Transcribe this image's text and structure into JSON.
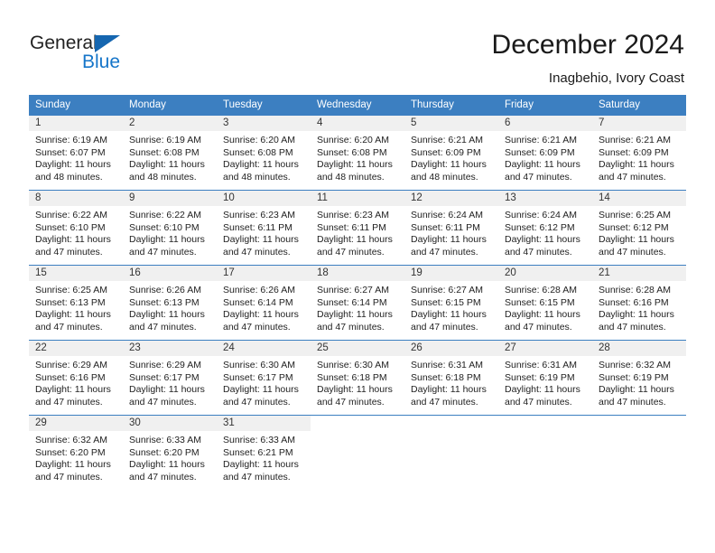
{
  "brand": {
    "name_part1": "General",
    "name_part2": "Blue"
  },
  "header": {
    "title": "December 2024",
    "subtitle": "Inagbehio, Ivory Coast"
  },
  "colors": {
    "header_blue": "#3c7fc1",
    "logo_blue": "#1575c9",
    "daynum_band": "#f0f0f0"
  },
  "calendar": {
    "weekday_headers": [
      "Sunday",
      "Monday",
      "Tuesday",
      "Wednesday",
      "Thursday",
      "Friday",
      "Saturday"
    ],
    "weeks": [
      [
        {
          "day": "1",
          "sunrise": "Sunrise: 6:19 AM",
          "sunset": "Sunset: 6:07 PM",
          "daylight_line1": "Daylight: 11 hours",
          "daylight_line2": "and 48 minutes."
        },
        {
          "day": "2",
          "sunrise": "Sunrise: 6:19 AM",
          "sunset": "Sunset: 6:08 PM",
          "daylight_line1": "Daylight: 11 hours",
          "daylight_line2": "and 48 minutes."
        },
        {
          "day": "3",
          "sunrise": "Sunrise: 6:20 AM",
          "sunset": "Sunset: 6:08 PM",
          "daylight_line1": "Daylight: 11 hours",
          "daylight_line2": "and 48 minutes."
        },
        {
          "day": "4",
          "sunrise": "Sunrise: 6:20 AM",
          "sunset": "Sunset: 6:08 PM",
          "daylight_line1": "Daylight: 11 hours",
          "daylight_line2": "and 48 minutes."
        },
        {
          "day": "5",
          "sunrise": "Sunrise: 6:21 AM",
          "sunset": "Sunset: 6:09 PM",
          "daylight_line1": "Daylight: 11 hours",
          "daylight_line2": "and 48 minutes."
        },
        {
          "day": "6",
          "sunrise": "Sunrise: 6:21 AM",
          "sunset": "Sunset: 6:09 PM",
          "daylight_line1": "Daylight: 11 hours",
          "daylight_line2": "and 47 minutes."
        },
        {
          "day": "7",
          "sunrise": "Sunrise: 6:21 AM",
          "sunset": "Sunset: 6:09 PM",
          "daylight_line1": "Daylight: 11 hours",
          "daylight_line2": "and 47 minutes."
        }
      ],
      [
        {
          "day": "8",
          "sunrise": "Sunrise: 6:22 AM",
          "sunset": "Sunset: 6:10 PM",
          "daylight_line1": "Daylight: 11 hours",
          "daylight_line2": "and 47 minutes."
        },
        {
          "day": "9",
          "sunrise": "Sunrise: 6:22 AM",
          "sunset": "Sunset: 6:10 PM",
          "daylight_line1": "Daylight: 11 hours",
          "daylight_line2": "and 47 minutes."
        },
        {
          "day": "10",
          "sunrise": "Sunrise: 6:23 AM",
          "sunset": "Sunset: 6:11 PM",
          "daylight_line1": "Daylight: 11 hours",
          "daylight_line2": "and 47 minutes."
        },
        {
          "day": "11",
          "sunrise": "Sunrise: 6:23 AM",
          "sunset": "Sunset: 6:11 PM",
          "daylight_line1": "Daylight: 11 hours",
          "daylight_line2": "and 47 minutes."
        },
        {
          "day": "12",
          "sunrise": "Sunrise: 6:24 AM",
          "sunset": "Sunset: 6:11 PM",
          "daylight_line1": "Daylight: 11 hours",
          "daylight_line2": "and 47 minutes."
        },
        {
          "day": "13",
          "sunrise": "Sunrise: 6:24 AM",
          "sunset": "Sunset: 6:12 PM",
          "daylight_line1": "Daylight: 11 hours",
          "daylight_line2": "and 47 minutes."
        },
        {
          "day": "14",
          "sunrise": "Sunrise: 6:25 AM",
          "sunset": "Sunset: 6:12 PM",
          "daylight_line1": "Daylight: 11 hours",
          "daylight_line2": "and 47 minutes."
        }
      ],
      [
        {
          "day": "15",
          "sunrise": "Sunrise: 6:25 AM",
          "sunset": "Sunset: 6:13 PM",
          "daylight_line1": "Daylight: 11 hours",
          "daylight_line2": "and 47 minutes."
        },
        {
          "day": "16",
          "sunrise": "Sunrise: 6:26 AM",
          "sunset": "Sunset: 6:13 PM",
          "daylight_line1": "Daylight: 11 hours",
          "daylight_line2": "and 47 minutes."
        },
        {
          "day": "17",
          "sunrise": "Sunrise: 6:26 AM",
          "sunset": "Sunset: 6:14 PM",
          "daylight_line1": "Daylight: 11 hours",
          "daylight_line2": "and 47 minutes."
        },
        {
          "day": "18",
          "sunrise": "Sunrise: 6:27 AM",
          "sunset": "Sunset: 6:14 PM",
          "daylight_line1": "Daylight: 11 hours",
          "daylight_line2": "and 47 minutes."
        },
        {
          "day": "19",
          "sunrise": "Sunrise: 6:27 AM",
          "sunset": "Sunset: 6:15 PM",
          "daylight_line1": "Daylight: 11 hours",
          "daylight_line2": "and 47 minutes."
        },
        {
          "day": "20",
          "sunrise": "Sunrise: 6:28 AM",
          "sunset": "Sunset: 6:15 PM",
          "daylight_line1": "Daylight: 11 hours",
          "daylight_line2": "and 47 minutes."
        },
        {
          "day": "21",
          "sunrise": "Sunrise: 6:28 AM",
          "sunset": "Sunset: 6:16 PM",
          "daylight_line1": "Daylight: 11 hours",
          "daylight_line2": "and 47 minutes."
        }
      ],
      [
        {
          "day": "22",
          "sunrise": "Sunrise: 6:29 AM",
          "sunset": "Sunset: 6:16 PM",
          "daylight_line1": "Daylight: 11 hours",
          "daylight_line2": "and 47 minutes."
        },
        {
          "day": "23",
          "sunrise": "Sunrise: 6:29 AM",
          "sunset": "Sunset: 6:17 PM",
          "daylight_line1": "Daylight: 11 hours",
          "daylight_line2": "and 47 minutes."
        },
        {
          "day": "24",
          "sunrise": "Sunrise: 6:30 AM",
          "sunset": "Sunset: 6:17 PM",
          "daylight_line1": "Daylight: 11 hours",
          "daylight_line2": "and 47 minutes."
        },
        {
          "day": "25",
          "sunrise": "Sunrise: 6:30 AM",
          "sunset": "Sunset: 6:18 PM",
          "daylight_line1": "Daylight: 11 hours",
          "daylight_line2": "and 47 minutes."
        },
        {
          "day": "26",
          "sunrise": "Sunrise: 6:31 AM",
          "sunset": "Sunset: 6:18 PM",
          "daylight_line1": "Daylight: 11 hours",
          "daylight_line2": "and 47 minutes."
        },
        {
          "day": "27",
          "sunrise": "Sunrise: 6:31 AM",
          "sunset": "Sunset: 6:19 PM",
          "daylight_line1": "Daylight: 11 hours",
          "daylight_line2": "and 47 minutes."
        },
        {
          "day": "28",
          "sunrise": "Sunrise: 6:32 AM",
          "sunset": "Sunset: 6:19 PM",
          "daylight_line1": "Daylight: 11 hours",
          "daylight_line2": "and 47 minutes."
        }
      ],
      [
        {
          "day": "29",
          "sunrise": "Sunrise: 6:32 AM",
          "sunset": "Sunset: 6:20 PM",
          "daylight_line1": "Daylight: 11 hours",
          "daylight_line2": "and 47 minutes."
        },
        {
          "day": "30",
          "sunrise": "Sunrise: 6:33 AM",
          "sunset": "Sunset: 6:20 PM",
          "daylight_line1": "Daylight: 11 hours",
          "daylight_line2": "and 47 minutes."
        },
        {
          "day": "31",
          "sunrise": "Sunrise: 6:33 AM",
          "sunset": "Sunset: 6:21 PM",
          "daylight_line1": "Daylight: 11 hours",
          "daylight_line2": "and 47 minutes."
        },
        {
          "day": "",
          "sunrise": "",
          "sunset": "",
          "daylight_line1": "",
          "daylight_line2": ""
        },
        {
          "day": "",
          "sunrise": "",
          "sunset": "",
          "daylight_line1": "",
          "daylight_line2": ""
        },
        {
          "day": "",
          "sunrise": "",
          "sunset": "",
          "daylight_line1": "",
          "daylight_line2": ""
        },
        {
          "day": "",
          "sunrise": "",
          "sunset": "",
          "daylight_line1": "",
          "daylight_line2": ""
        }
      ]
    ]
  }
}
